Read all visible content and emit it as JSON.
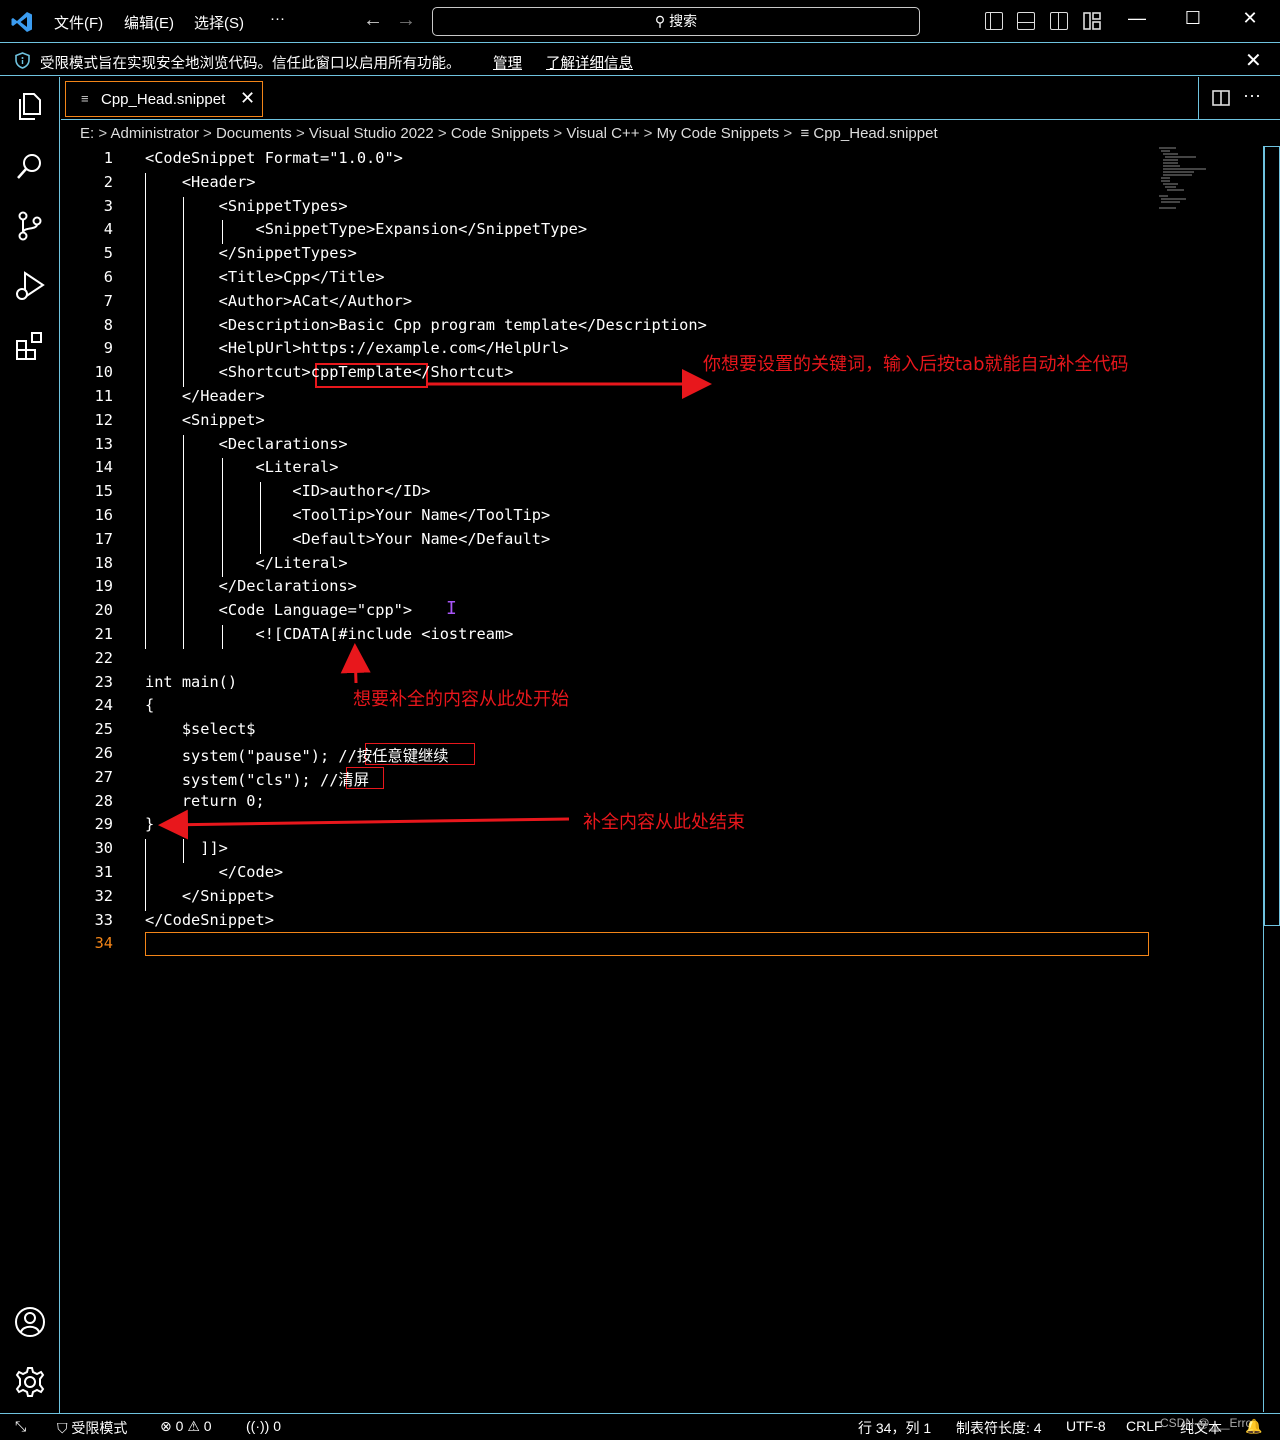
{
  "titlebar": {
    "menus": [
      "文件(F)",
      "编辑(E)",
      "选择(S)",
      "···"
    ],
    "search_label": "搜索"
  },
  "banner": {
    "message": "受限模式旨在实现安全地浏览代码。信任此窗口以启用所有功能。",
    "manage": "管理",
    "learn_more": "了解详细信息"
  },
  "tab": {
    "label": "Cpp_Head.snippet"
  },
  "breadcrumb": [
    "E:",
    "Administrator",
    "Documents",
    "Visual Studio 2022",
    "Code Snippets",
    "Visual C++",
    "My Code Snippets",
    "Cpp_Head.snippet"
  ],
  "editor": {
    "lines": [
      "<CodeSnippet Format=\"1.0.0\">",
      "    <Header>",
      "        <SnippetTypes>",
      "            <SnippetType>Expansion</SnippetType>",
      "        </SnippetTypes>",
      "        <Title>Cpp</Title>",
      "        <Author>ACat</Author>",
      "        <Description>Basic Cpp program template</Description>",
      "        <HelpUrl>https://example.com</HelpUrl>",
      "        <Shortcut>cppTemplate</Shortcut>",
      "    </Header>",
      "    <Snippet>",
      "        <Declarations>",
      "            <Literal>",
      "                <ID>author</ID>",
      "                <ToolTip>Your Name</ToolTip>",
      "                <Default>Your Name</Default>",
      "            </Literal>",
      "        </Declarations>",
      "        <Code Language=\"cpp\">",
      "            <![CDATA[#include <iostream>",
      "",
      "int main()",
      "{",
      "    $select$",
      "    system(\"pause\"); //按任意键继续",
      "    system(\"cls\"); //清屏",
      "    return 0;",
      "}",
      "      ]]>",
      "        </Code>",
      "    </Snippet>",
      "</CodeSnippet>",
      ""
    ],
    "current_line": 34
  },
  "annotations": {
    "shortcut_note": "你想要设置的关键词，输入后按tab就能自动补全代码",
    "start_note": "想要补全的内容从此处开始",
    "end_note": "补全内容从此处结束"
  },
  "statusbar": {
    "restricted": "受限模式",
    "errors": "0",
    "warnings": "0",
    "ports": "0",
    "position": "行 34，列 1",
    "tab_size": "制表符长度: 4",
    "encoding": "UTF-8",
    "eol": "CRLF",
    "language": "纯文本",
    "watermark": "CSDN @___Error"
  },
  "colors": {
    "accent_border": "#6fc3df",
    "annotation": "#e8171c",
    "active_line": "#f38518"
  }
}
